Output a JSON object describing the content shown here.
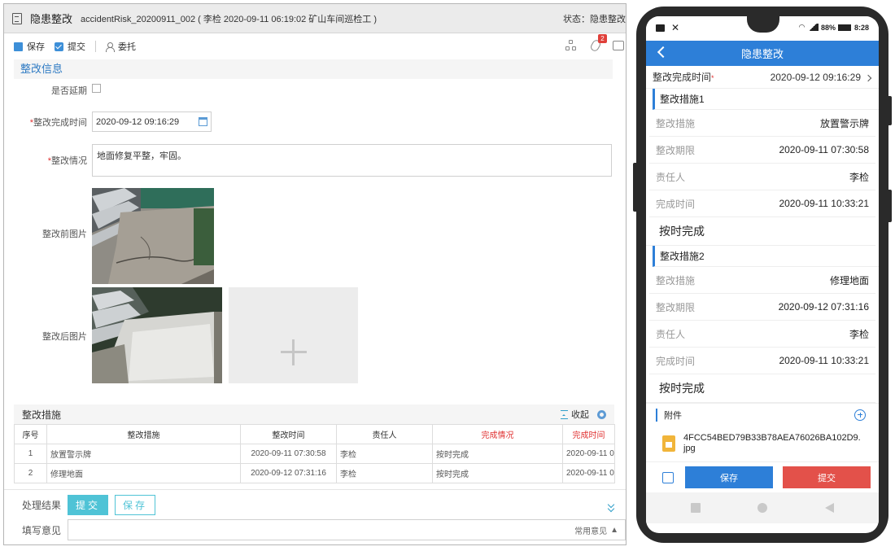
{
  "desktop": {
    "title": "隐患整改",
    "subtitle": "accidentRisk_20200911_002 ( 李检  2020-09-11 06:19:02 矿山车间巡检工 )",
    "status": "状态：隐患整改",
    "toolbar": {
      "save": "保存",
      "submit": "提交",
      "delegate": "委托",
      "badge_count": "2"
    },
    "section_title": "整改信息",
    "form": {
      "delay_label": "是否延期",
      "finish_time_label": "整改完成时间",
      "finish_time_value": "2020-09-12 09:16:29",
      "status_label": "整改情况",
      "status_value": "地面修复平整，牢固。",
      "before_label": "整改前图片",
      "after_label": "整改后图片",
      "required_mark": "*"
    },
    "measures": {
      "title": "整改措施",
      "collapse": "收起",
      "columns": [
        "序号",
        "整改措施",
        "整改时间",
        "责任人",
        "完成情况",
        "完成时间"
      ],
      "rows": [
        [
          "1",
          "放置警示牌",
          "2020-09-11 07:30:58",
          "李检",
          "按时完成",
          "2020-09-11 09"
        ],
        [
          "2",
          "修理地面",
          "2020-09-12 07:31:16",
          "李检",
          "按时完成",
          "2020-09-11 09"
        ]
      ]
    },
    "bottom": {
      "result_label": "处理结果",
      "submit": "提交",
      "save": "保存",
      "opinion_label": "填写意见",
      "common_opinion": "常用意见"
    }
  },
  "mobile": {
    "status_bar": {
      "battery": "88%",
      "time": "8:28"
    },
    "nav_title": "隐患整改",
    "finish_time_label": "整改完成时间",
    "finish_time_value": "2020-09-12 09:16:29",
    "measures": [
      {
        "group": "整改措施1",
        "measure_label": "整改措施",
        "measure": "放置警示牌",
        "deadline_label": "整改期限",
        "deadline": "2020-09-11 07:30:58",
        "owner_label": "责任人",
        "owner": "李检",
        "done_label": "完成时间",
        "done": "2020-09-11 10:33:21",
        "result": "按时完成"
      },
      {
        "group": "整改措施2",
        "measure_label": "整改措施",
        "measure": "修理地面",
        "deadline_label": "整改期限",
        "deadline": "2020-09-12 07:31:16",
        "owner_label": "责任人",
        "owner": "李检",
        "done_label": "完成时间",
        "done": "2020-09-11 10:33:21",
        "result": "按时完成"
      }
    ],
    "attachment_label": "附件",
    "attachment_file": "4FCC54BED79B33B78AEA76026BA102D9.jpg",
    "save": "保存",
    "submit": "提交"
  }
}
